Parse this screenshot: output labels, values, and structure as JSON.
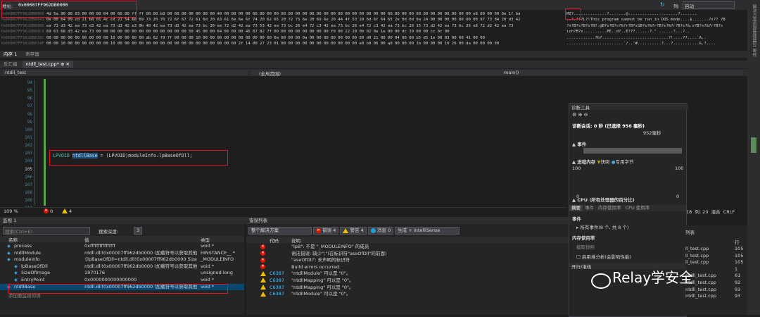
{
  "memory": {
    "address_label": "地址:",
    "address_value": "0x00007FF962DB0000",
    "column_label": "列:",
    "column_value": "自动",
    "rows": [
      {
        "addr": "0x00007FF962DB0000",
        "hex": "4d 5a 90 00 03 00 00 00 04 00 00 00 ff ff 00 00 b8 00 00 00 00 00 00 00 40 00 00 00 00 00 00 00 00 00 00 00 00 00 00 00 00 00 00 00 00 00 00 00 00 00 00 00 00 00 00 00 00 00 00 00 e8 00 00 00 0e 1f ba",
        "ascii": "MZ?..............?.......@.....................?......."
      },
      {
        "addr": "0x00007FF962DB0043",
        "hex": "0e 00 b4 09 cd 21 b8 01 4c cd 21 54 68 69 73 20 70 72 6f 67 72 61 6d 20 63 61 6e 6e 6f 74 20 62 65 20 72 75 6e 20 69 6e 20 44 4f 53 20 6d 6f 64 65 2e 0d 0d 0a 24 00 00 00 00 00 00 00 97 73 84 20 d3 42",
        "ascii": "..?.?!?L?!This program cannot be run in DOS mode....$.......?s?? ?B"
      },
      {
        "addr": "0x00007FF962DB0086",
        "hex": "ea 73 d3 42 ea 73 d3 42 ea 73 d3 42 e3 0b 40 42 ea 73 d3 42 ea 73 bc 26 ee 72 d2 42 ea 73 53 42 ea 73 bc 26 e4 72 c3 42 ea 73 bc 26 e4 72 c3 42 ea 73 bc 26 15 73 d2 42 ea 73 bc 26 e8 72 d2 42 ea 73",
        "ascii": "?s?B?s?B?s?B?.@B?s?B?s?&?r?B?sSB?s?&?r?B?s?&?r?B?s?&.s?B?s?&?r?B?s"
      },
      {
        "addr": "0x00007FF962DB00C9",
        "hex": "69 63 68 d3 42 ea 73 00 00 00 00 00 00 00 00 00 00 00 00 00 50 45 00 00 64 86 09 00 45 87 82 7f 00 00 00 00 00 00 00 00 f0 00 22 20 0b 02 0e 1e 00 00 dc 10 00 00 cc 0c 00",
        "ascii": "ich?B?s..........PE..d?..E???......?.\" ......?...?.."
      },
      {
        "addr": "0x00007FF962DB010C",
        "hex": "00 00 00 00 00 00 00 00 00 10 00 00 00 00 db 62 f9 7f 00 00 00 10 00 00 00 00 00 00 00 00 00 00 0a 00 00 00 0a 00 00 00 00 00 00 00 00 d0 21 00 00 04 00 00 b5 d5 1e 00 03 00 60 41 00 00",
        "ascii": "............?b?............................?!....??....`A.."
      },
      {
        "addr": "0x00007FF962DB014F",
        "hex": "00 00 10 00 00 00 00 00 00 10 00 00 00 00 00 00 00 00 00 00 00 00 00 00 00 00 60 2f 14 00 27 23 01 00 00 00 00 00 00 00 00 00 00 00 e8 b8 06 00 a8 00 00 00 1b 00 00 00 10 26 00 da 00 00 00 00",
        "ascii": "........................`/..'#..........?...?...........&.?...."
      }
    ],
    "subtabs": [
      "内存 1",
      "寄存器"
    ]
  },
  "right_strip_labels": [
    "解决方案资源管理器",
    "Git 更改"
  ],
  "doc_tabs": [
    "反汇编",
    "ntdll_test.cpp*"
  ],
  "nav_bar": {
    "project": "ntdll_test",
    "scope": "(全局范围)",
    "member": "main()"
  },
  "editor": {
    "line_numbers": [
      "94",
      "95",
      "96",
      "97",
      "98",
      "99",
      "100",
      "101",
      "102",
      "103",
      "104",
      "105",
      "106",
      "107",
      "108",
      "109",
      "110"
    ],
    "code_line": {
      "type": "LPVOID",
      "var": "ntdllBase",
      "rest": " = (LPVOID)moduleInfo.lpBaseOfDll;"
    },
    "zoom": "109 %",
    "errors": "0",
    "warnings": "4"
  },
  "status_right": {
    "line": "行: 105",
    "char": "18",
    "col": "列: 20",
    "mode": "混合",
    "eol": "CRLF"
  },
  "diagnostics": {
    "title": "诊断工具",
    "session": "诊断会话: 0 秒 (已选择 956 毫秒)",
    "ms_label": "952毫秒",
    "events_label": "▲ 事件",
    "process_mem_label": "▲ 进程内存",
    "fast_snap": "快照",
    "private_bytes": "专用字节",
    "mem_max": "100",
    "mem_min": "0",
    "cpu_label": "▲ CPU (所有处理器的百分比)",
    "tabs": [
      "摘要",
      "事件",
      "内存使用率",
      "CPU 使用率"
    ],
    "events_head": "事件",
    "all_events": "所有事件(8 个, 共 8 个)",
    "mem_usage_head": "内存使用率",
    "take_snapshot": "截取快照",
    "heap_profile": "启用堆分析(会影响性能)",
    "bottom_tab": "开行/堆栈"
  },
  "watch": {
    "title": "监视 1",
    "search_placeholder": "搜索(Ctrl+E)",
    "depth_label": "搜索深度:",
    "depth_value": "3",
    "columns": [
      "名称",
      "值",
      "类型"
    ],
    "rows": [
      {
        "name": "process",
        "value": "0xffffffffffffffff",
        "type": "void *",
        "indent": 1
      },
      {
        "name": "ntdllModule",
        "value": "ntdll.dll!0x00007ff962db0000 (加载符号以获取其他...",
        "type": "HINSTANCE__ *",
        "indent": 1
      },
      {
        "name": "moduleInfo",
        "value": "{lpBaseOfDll=ntdll.dll!0x00007ff962db0000 SizeOfIm...",
        "type": "_MODULEINFO",
        "indent": 1
      },
      {
        "name": "lpBaseOfDll",
        "value": "ntdll.dll!0x00007ff962db0000 (加载符号以获取其他...",
        "type": "void *",
        "indent": 2
      },
      {
        "name": "SizeOfImage",
        "value": "1970176",
        "type": "unsigned long",
        "indent": 2
      },
      {
        "name": "EntryPoint",
        "value": "0x0000000000000000",
        "type": "void *",
        "indent": 2
      },
      {
        "name": "ntdllBase",
        "value": "ntdll.dll!0x00007ff962db0000 (加载符号以获取其他...",
        "type": "void *",
        "indent": 1
      }
    ],
    "add_item": "添加要监视的项"
  },
  "errors": {
    "title": "错误列表",
    "scope": "整个解决方案",
    "errors_btn": "错误 4",
    "warnings_btn": "警告 4",
    "messages_btn": "消息 0",
    "build_filter": "生成 + IntelliSense",
    "columns": [
      "代码",
      "说明"
    ],
    "rows": [
      {
        "kind": "error",
        "code": "",
        "desc": "\"lpB\": 不是 \"_MODULEINFO\" 的成员"
      },
      {
        "kind": "error",
        "code": "",
        "desc": "语法错误: 缺少\";\"(在标识符\"aseOfDll\"的前面)"
      },
      {
        "kind": "error",
        "code": "",
        "desc": "\"aseOfDll\": 未声明的标识符"
      },
      {
        "kind": "error",
        "code": "",
        "desc": "Build errors occurred."
      },
      {
        "kind": "warn",
        "code": "C6387",
        "desc": "\"ntdllModule\" 可以是 \"0\"。"
      },
      {
        "kind": "warn",
        "code": "C6387",
        "desc": "\"ntdllMapping\" 可以是 \"0\"。"
      },
      {
        "kind": "warn",
        "code": "C6387",
        "desc": "\"ntdllMapping\" 可以是 \"0\"。"
      },
      {
        "kind": "warn",
        "code": "C6387",
        "desc": "\"ntdllModule\" 可以是 \"0\"。"
      }
    ],
    "right_cols_head": {
      "list": "列表",
      "line": "行"
    },
    "right_rows": [
      {
        "proj": "",
        "file": "ll_test.cpp",
        "line": "105"
      },
      {
        "proj": "",
        "file": "ll_test.cpp",
        "line": "105"
      },
      {
        "proj": "",
        "file": "ll_test.cpp",
        "line": "105"
      },
      {
        "proj": "",
        "file": "",
        "line": "1"
      },
      {
        "proj": "ntdll_test",
        "file": "ntdll_test.cpp",
        "line": "61"
      },
      {
        "proj": "ntdll_test",
        "file": "ntdll_test.cpp",
        "line": "92"
      },
      {
        "proj": "ntdll_test",
        "file": "ntdll_test.cpp",
        "line": "93"
      },
      {
        "proj": "ntdll_test",
        "file": "ntdll_test.cpp",
        "line": "93"
      }
    ]
  },
  "watermark": "Relay学安全"
}
